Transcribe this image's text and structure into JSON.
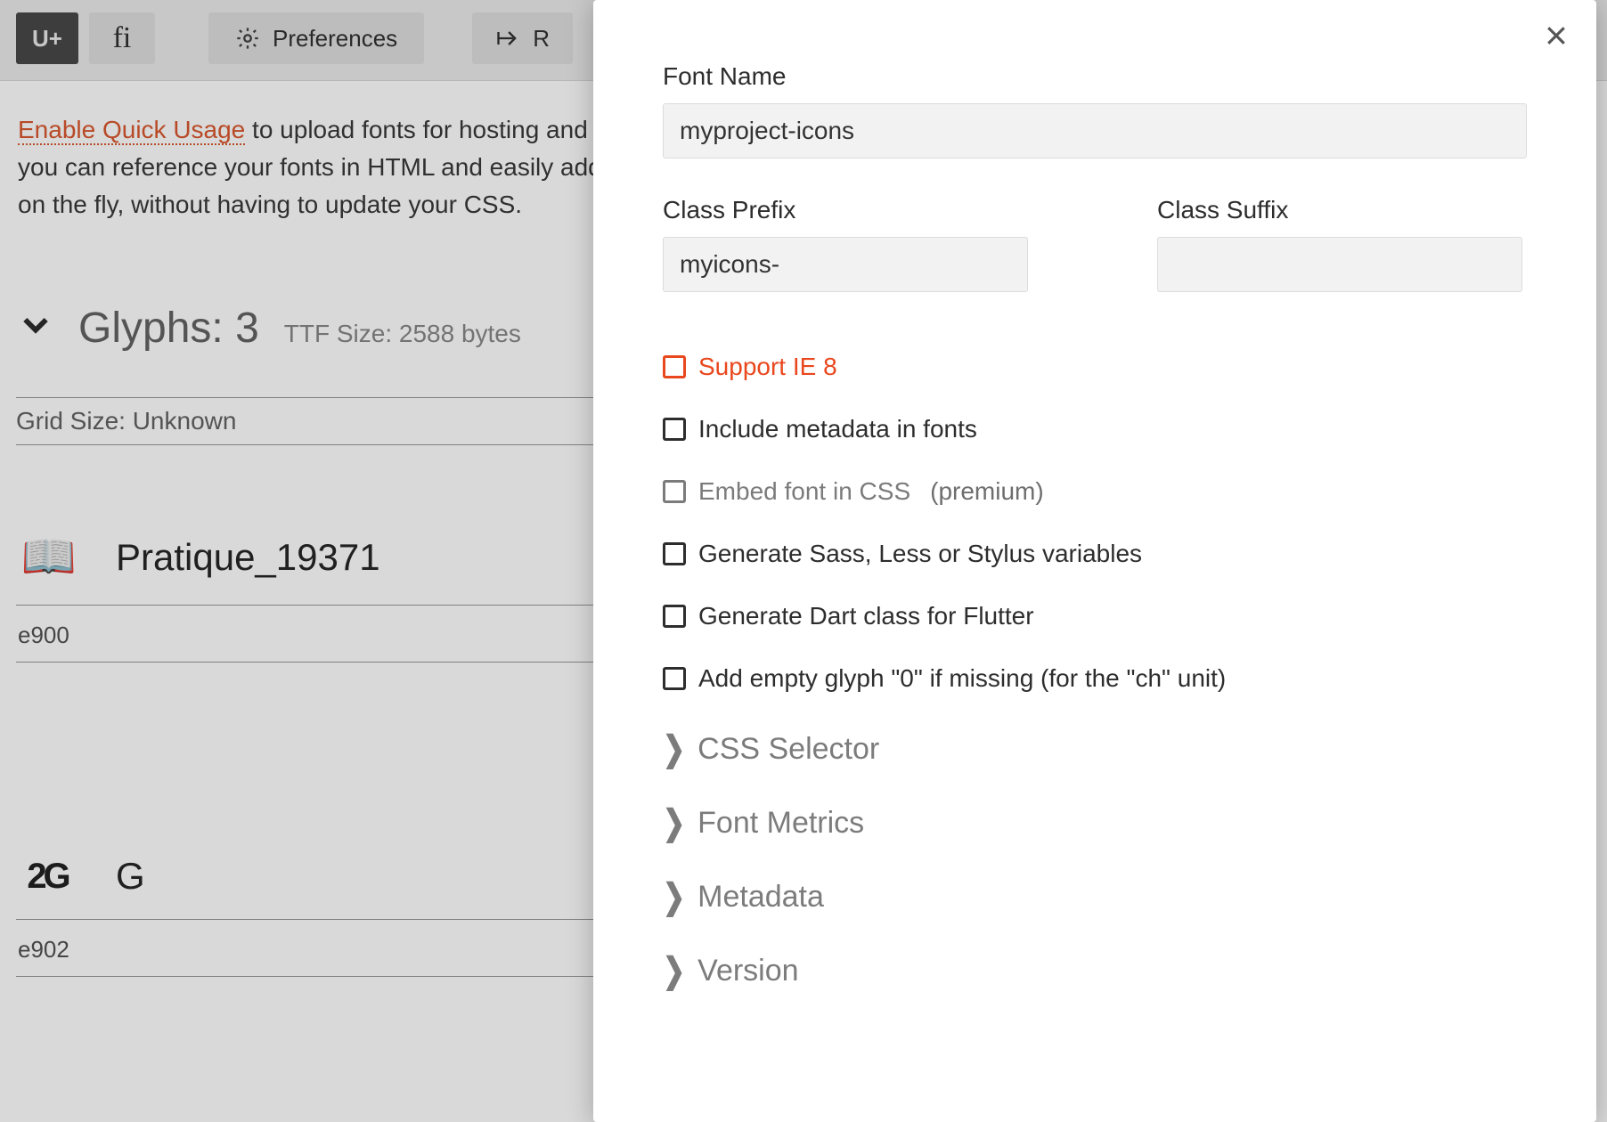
{
  "toolbar": {
    "codes_label": "U+",
    "ligatures_label": "fi",
    "preferences_label": "Preferences",
    "reset_label": "R"
  },
  "intro": {
    "link_text": "Enable Quick Usage",
    "rest_line1": " to upload fonts for hosting and get a CDN link so that",
    "line2": "you can reference your fonts in HTML and easily add new glyphs to existing fonts",
    "line3": "on the fly, without having to update your CSS."
  },
  "glyphs": {
    "heading": "Glyphs: 3",
    "ttf_info": "TTF Size: 2588 bytes",
    "grid_size": "Grid Size: Unknown",
    "items": [
      {
        "icon": "book-icon",
        "icon_text": "📖",
        "name": "Pratique_19371",
        "code": "e900"
      },
      {
        "icon": "2g-icon",
        "icon_text": "2G",
        "name": "G",
        "code": "e902"
      }
    ]
  },
  "modal": {
    "font_name_label": "Font Name",
    "font_name_value": "myproject-icons",
    "class_prefix_label": "Class Prefix",
    "class_prefix_value": "myicons-",
    "class_suffix_label": "Class Suffix",
    "class_suffix_value": "",
    "checks": {
      "ie8": "Support IE 8",
      "metadata": "Include metadata in fonts",
      "embed": "Embed font in CSS",
      "embed_note": "(premium)",
      "sass": "Generate Sass, Less or Stylus variables",
      "dart": "Generate Dart class for Flutter",
      "zero": "Add empty glyph \"0\" if missing (for the \"ch\" unit)"
    },
    "sections": {
      "css_selector": "CSS Selector",
      "font_metrics": "Font Metrics",
      "metadata": "Metadata",
      "version": "Version"
    }
  }
}
